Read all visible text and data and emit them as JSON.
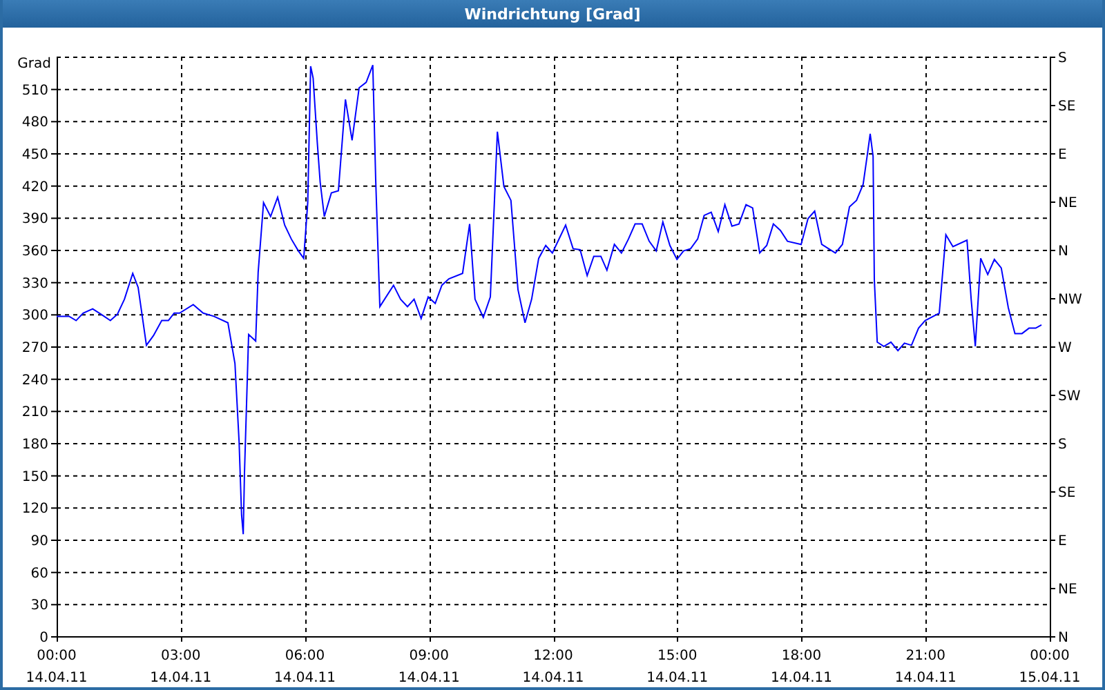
{
  "window": {
    "title": "Windrichtung [Grad]"
  },
  "chart": {
    "chart_data": {
      "type": "line",
      "ylabel": "Grad",
      "x": [
        0,
        0.3,
        0.47,
        0.64,
        0.87,
        1.07,
        1.3,
        1.47,
        1.64,
        1.84,
        1.97,
        2.17,
        2.34,
        2.54,
        2.7,
        2.84,
        2.97,
        3.3,
        3.54,
        3.8,
        4.14,
        4.31,
        4.41,
        4.47,
        4.51,
        4.54,
        4.64,
        4.81,
        4.87,
        5.0,
        5.17,
        5.34,
        5.51,
        5.67,
        5.84,
        5.97,
        6.07,
        6.14,
        6.2,
        6.3,
        6.37,
        6.47,
        6.64,
        6.81,
        6.98,
        7.14,
        7.31,
        7.48,
        7.64,
        7.71,
        7.81,
        8.14,
        8.31,
        8.48,
        8.64,
        8.81,
        8.98,
        9.15,
        9.31,
        9.48,
        9.81,
        9.98,
        10.11,
        10.31,
        10.48,
        10.65,
        10.81,
        10.98,
        11.15,
        11.32,
        11.48,
        11.65,
        11.82,
        11.98,
        12.3,
        12.48,
        12.65,
        12.82,
        12.98,
        13.15,
        13.3,
        13.48,
        13.65,
        13.82,
        13.98,
        14.15,
        14.32,
        14.49,
        14.65,
        14.82,
        14.99,
        15.15,
        15.32,
        15.49,
        15.65,
        15.82,
        15.99,
        16.15,
        16.32,
        16.49,
        16.66,
        16.82,
        16.99,
        17.16,
        17.32,
        17.49,
        17.66,
        17.99,
        18.16,
        18.32,
        18.49,
        18.82,
        18.99,
        19.16,
        19.33,
        19.49,
        19.6,
        19.66,
        19.73,
        19.76,
        19.83,
        19.99,
        20.16,
        20.33,
        20.49,
        20.66,
        20.83,
        20.99,
        21.33,
        21.49,
        21.66,
        22.0,
        22.1,
        22.2,
        22.33,
        22.5,
        22.66,
        22.83,
        23.0,
        23.16,
        23.33,
        23.5,
        23.66,
        23.8
      ],
      "series": [
        {
          "color": "#0000ff",
          "values": [
            298,
            298,
            294,
            301,
            305,
            300,
            294,
            300,
            314,
            338,
            325,
            271,
            280,
            294,
            294,
            301,
            301,
            309,
            301,
            298,
            292,
            254,
            181,
            113,
            95,
            152,
            281,
            275,
            339,
            404,
            391,
            409,
            383,
            370,
            359,
            352,
            404,
            531,
            520,
            460,
            423,
            391,
            413,
            415,
            500,
            462,
            511,
            516,
            532,
            425,
            307,
            327,
            314,
            307,
            314,
            296,
            316,
            310,
            327,
            333,
            338,
            384,
            314,
            297,
            316,
            470,
            419,
            406,
            323,
            292,
            314,
            352,
            364,
            357,
            383,
            361,
            360,
            336,
            354,
            354,
            341,
            365,
            357,
            370,
            384,
            384,
            368,
            359,
            386,
            364,
            351,
            359,
            361,
            370,
            392,
            395,
            377,
            402,
            382,
            384,
            402,
            399,
            357,
            364,
            384,
            378,
            368,
            365,
            389,
            396,
            365,
            357,
            365,
            400,
            406,
            421,
            451,
            468,
            447,
            332,
            274,
            270,
            274,
            266,
            273,
            271,
            287,
            294,
            301,
            374,
            363,
            369,
            314,
            270,
            352,
            337,
            351,
            343,
            306,
            282,
            282,
            287,
            287,
            290
          ]
        }
      ],
      "xlim": [
        0,
        24
      ],
      "ylim": [
        0,
        540
      ],
      "grid": true,
      "xticks": [
        {
          "value": 0,
          "label": "00:00"
        },
        {
          "value": 3,
          "label": "03:00"
        },
        {
          "value": 6,
          "label": "06:00"
        },
        {
          "value": 9,
          "label": "09:00"
        },
        {
          "value": 12,
          "label": "12:00"
        },
        {
          "value": 15,
          "label": "15:00"
        },
        {
          "value": 18,
          "label": "18:00"
        },
        {
          "value": 21,
          "label": "21:00"
        },
        {
          "value": 24,
          "label": "00:00"
        }
      ],
      "yticks": [
        0,
        30,
        60,
        90,
        120,
        150,
        180,
        210,
        240,
        270,
        300,
        330,
        360,
        390,
        420,
        450,
        480,
        510
      ]
    },
    "dates": [
      "14.04.11",
      "14.04.11",
      "14.04.11",
      "14.04.11",
      "14.04.11",
      "14.04.11",
      "14.04.11",
      "14.04.11",
      "15.04.11"
    ],
    "directions": [
      "S",
      "SE",
      "E",
      "NE",
      "N",
      "NW",
      "W",
      "SW",
      "S",
      "SE",
      "E",
      "NE",
      "N"
    ]
  }
}
